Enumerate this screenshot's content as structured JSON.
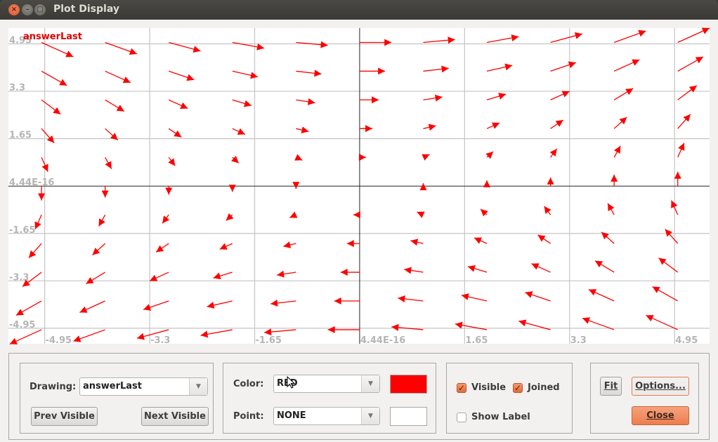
{
  "window": {
    "title": "Plot Display",
    "controls": [
      "close",
      "minimize",
      "maximize"
    ]
  },
  "chart_data": {
    "type": "vector-field",
    "series_label": "answerLast",
    "field": "F(x,y) = (y, x)",
    "arrow_scale": 0.1,
    "sample_x": [
      -5,
      -4,
      -3,
      -2,
      -1,
      0,
      1,
      2,
      3,
      4,
      5
    ],
    "sample_y": [
      5,
      4,
      3,
      2,
      1,
      0,
      -1,
      -2,
      -3,
      -4,
      -5
    ],
    "xlim": [
      -5.52,
      5.5
    ],
    "ylim": [
      -5.49,
      5.5
    ],
    "x_ticks": [
      "-4.95",
      "-3.3",
      "-1.65",
      "4.44E-16",
      "1.65",
      "3.3",
      "4.95"
    ],
    "x_tick_values": [
      -4.95,
      -3.3,
      -1.65,
      0,
      1.65,
      3.3,
      4.95
    ],
    "y_ticks": [
      "4.95",
      "3.3",
      "1.65",
      "4.44E-16",
      "-1.65",
      "-3.3",
      "-4.95"
    ],
    "y_tick_values": [
      4.95,
      3.3,
      1.65,
      0,
      -1.65,
      -3.3,
      -4.95
    ],
    "grid": true,
    "series_color": "#ff0000",
    "legend": "top-left"
  },
  "controls": {
    "drawing_label": "Drawing:",
    "drawing_value": "answerLast",
    "prev_visible": "Prev Visible",
    "next_visible": "Next Visible",
    "color_label": "Color:",
    "color_value": "RED",
    "color_swatch": "#ff0000",
    "point_label": "Point:",
    "point_value": "NONE",
    "point_swatch": "#ffffff",
    "visible_label": "Visible",
    "visible_checked": true,
    "joined_label": "Joined",
    "joined_checked": true,
    "show_label_label": "Show Label",
    "show_label_checked": false,
    "fit_label": "Fit",
    "options_label": "Options...",
    "close_label": "Close"
  }
}
